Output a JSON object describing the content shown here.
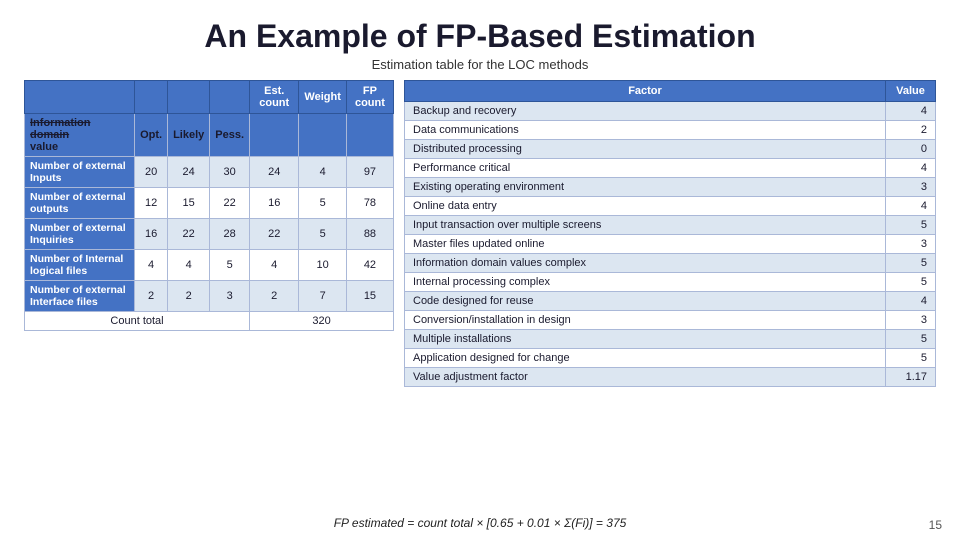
{
  "title": "An Example of FP-Based Estimation",
  "subtitle": "Estimation table for the LOC methods",
  "left_table": {
    "headers": [
      "",
      "Opt.",
      "Likely",
      "Pess.",
      "Est. count",
      "Weight",
      "FP count"
    ],
    "info_domain_row": {
      "label": "Information domain value"
    },
    "rows": [
      {
        "label": "Number of external Inputs",
        "opt": "20",
        "likely": "24",
        "pess": "30",
        "est_count": "24",
        "weight": "4",
        "fp_count": "97"
      },
      {
        "label": "Number of external outputs",
        "opt": "12",
        "likely": "15",
        "pess": "22",
        "est_count": "16",
        "weight": "5",
        "fp_count": "78"
      },
      {
        "label": "Number of external Inquiries",
        "opt": "16",
        "likely": "22",
        "pess": "28",
        "est_count": "22",
        "weight": "5",
        "fp_count": "88"
      },
      {
        "label": "Number of Internal logical files",
        "opt": "4",
        "likely": "4",
        "pess": "5",
        "est_count": "4",
        "weight": "10",
        "fp_count": "42"
      },
      {
        "label": "Number of external Interface files",
        "opt": "2",
        "likely": "2",
        "pess": "3",
        "est_count": "2",
        "weight": "7",
        "fp_count": "15"
      }
    ],
    "total_row": {
      "label": "Count total",
      "value": "320"
    }
  },
  "right_table": {
    "headers": [
      "Factor",
      "Value"
    ],
    "rows": [
      {
        "factor": "Backup and recovery",
        "value": "4",
        "highlight": true
      },
      {
        "factor": "Data communications",
        "value": "2",
        "highlight": false
      },
      {
        "factor": "Distributed  processing",
        "value": "0",
        "highlight": true
      },
      {
        "factor": "Performance critical",
        "value": "4",
        "highlight": false
      },
      {
        "factor": "Existing operating environment",
        "value": "3",
        "highlight": true
      },
      {
        "factor": "Online data entry",
        "value": "4",
        "highlight": false
      },
      {
        "factor": "Input transaction over multiple screens",
        "value": "5",
        "highlight": true
      },
      {
        "factor": "Master files updated online",
        "value": "3",
        "highlight": false
      },
      {
        "factor": "Information domain values complex",
        "value": "5",
        "highlight": true
      },
      {
        "factor": "Internal processing complex",
        "value": "5",
        "highlight": false
      },
      {
        "factor": "Code designed for reuse",
        "value": "4",
        "highlight": true
      },
      {
        "factor": "Conversion/installation in design",
        "value": "3",
        "highlight": false
      },
      {
        "factor": "Multiple installations",
        "value": "5",
        "highlight": true
      },
      {
        "factor": "Application designed for change",
        "value": "5",
        "highlight": false
      },
      {
        "factor": "Value adjustment factor",
        "value": "1.17",
        "highlight": true
      }
    ]
  },
  "formula": "FP estimated = count total × [0.65 + 0.01 × Σ(Fi)] = 375",
  "page_number": "15"
}
